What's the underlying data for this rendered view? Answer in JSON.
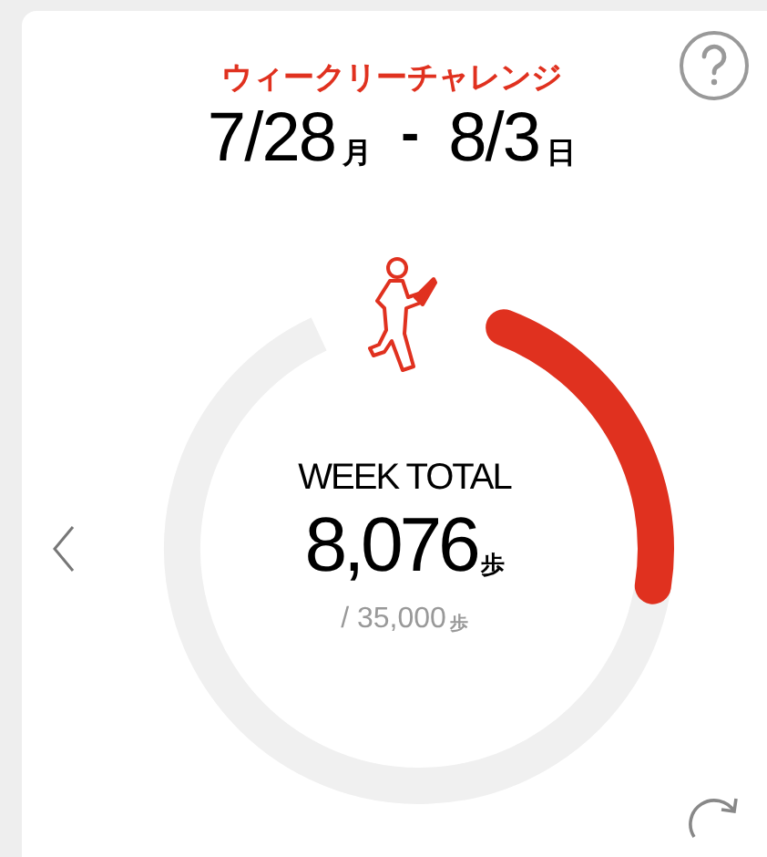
{
  "header": {
    "title": "ウィークリーチャレンジ",
    "start_date": "7/28",
    "start_day": "月",
    "separator": "-",
    "end_date": "8/3",
    "end_day": "日"
  },
  "progress": {
    "label": "WEEK TOTAL",
    "value": "8,076",
    "unit": "歩",
    "goal": "/ 35,000",
    "goal_unit": "歩"
  }
}
